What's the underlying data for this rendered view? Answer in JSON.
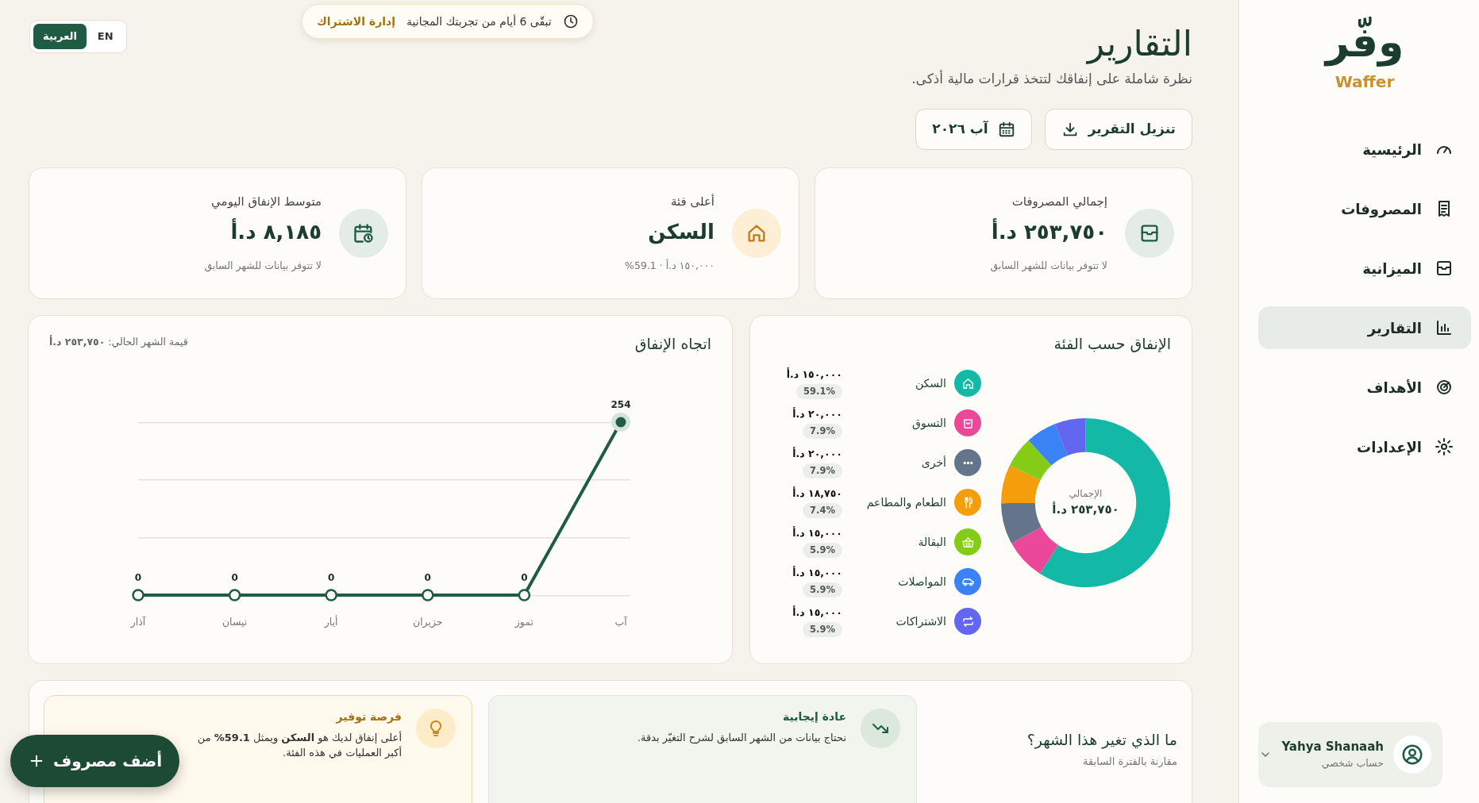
{
  "top_bar": {
    "trial": {
      "text": "تبقّى 6 أيام من تجربتك المجانية",
      "link": "إدارة الاشتراك"
    },
    "languages": [
      {
        "label": "EN",
        "selected": false
      },
      {
        "label": "العربية",
        "selected": true
      }
    ]
  },
  "header": {
    "title": "التقارير",
    "subtitle": "نظرة شاملة على إنفاقك لتتخذ قرارات مالية أذكى.",
    "buttons": [
      {
        "kind": "download",
        "label": "تنزيل التقرير"
      },
      {
        "kind": "date",
        "label": "آب ٢٠٢٦"
      }
    ]
  },
  "stats": [
    {
      "label": "إجمالي المصروفات",
      "value": "٢٥٣,٧٥٠ د.أ",
      "note": "لا تتوفر بيانات للشهر السابق"
    },
    {
      "label": "أعلى فئة",
      "value": "السكن",
      "note": "١٥٠,٠٠٠ د.أ · 59.1%"
    },
    {
      "label": "متوسط الإنفاق اليومي",
      "value": "٨,١٨٥ د.أ",
      "note": "لا تتوفر بيانات للشهر السابق"
    }
  ],
  "category_card": {
    "title": "الإنفاق حسب الفئة",
    "total_label": "الإجمالي",
    "total": "٢٥٣,٧٥٠ د.أ",
    "legend": [
      {
        "amount": "١٥٠,٠٠٠ د.أ",
        "percent": "59.1%",
        "color": "#14b8a6"
      },
      {
        "amount": "٢٠,٠٠٠ د.أ",
        "percent": "7.9%",
        "color": "#ec4899"
      },
      {
        "amount": "٢٠,٠٠٠ د.أ",
        "percent": "7.9%",
        "color": "#64748b"
      },
      {
        "amount": "١٨,٧٥٠ د.أ",
        "percent": "7.4%",
        "color": "#f59e0b"
      },
      {
        "amount": "١٥,٠٠٠ د.أ",
        "percent": "5.9%",
        "color": "#84cc16"
      },
      {
        "amount": "١٥,٠٠٠ د.أ",
        "percent": "5.9%",
        "color": "#3b82f6"
      },
      {
        "amount": "١٥,٠٠٠ د.أ",
        "percent": "5.9%",
        "color": "#6366f1"
      }
    ],
    "chart_data": {
      "type": "donut",
      "categories": [
        "السكن",
        "التسوق",
        "أخرى",
        "الطعام والمطاعم",
        "البقالة",
        "المواصلات",
        "الاشتراكات"
      ],
      "values": [
        59.1,
        7.9,
        7.9,
        7.4,
        5.9,
        5.9,
        5.9
      ]
    }
  },
  "trend_card": {
    "title": "اتجاه الإنفاق",
    "current": "قيمة الشهر الحالي: **٢٥٣,٧٥٠ د.أ**",
    "chart_data": {
      "type": "line",
      "categories": [
        "آذار",
        "نيسان",
        "أيار",
        "حزيران",
        "تموز",
        "آب"
      ],
      "series": [
        {
          "color": "#1f5c43",
          "marker": "o",
          "values": [
            0,
            0,
            0,
            0,
            0,
            254
          ]
        }
      ],
      "data_labels": true
    }
  },
  "changes": {
    "title": "ما الذي تغير هذا الشهر؟",
    "subtitle": "مقارنة بالفترة السابقة",
    "insights": [
      {
        "kind": "positive",
        "label": "عادة إيجابية",
        "lines": [
          "نحتاج بيانات من الشهر السابق لشرح التغيّر بدقة."
        ]
      },
      {
        "kind": "saving",
        "label": "فرصة توفير",
        "lines": [
          "أعلى إنفاق لديك هو **السكن** ويمثل **59.1%** من",
          "أكبر العمليات في هذه الفئة."
        ]
      }
    ]
  },
  "fab": {
    "label": "أضف مصروف"
  },
  "sidebar": {
    "logo": "وفّر",
    "logo_latin": "Waffer",
    "items": [
      {
        "label": "الرئيسية",
        "selected": false
      },
      {
        "label": "المصروفات",
        "selected": false
      },
      {
        "label": "الميزانية",
        "selected": false
      },
      {
        "label": "التقارير",
        "selected": true
      },
      {
        "label": "الأهداف",
        "selected": false
      },
      {
        "label": "الإعدادات",
        "selected": false
      }
    ],
    "user": {
      "name": "Yahya Shanaah",
      "subtitle": "حساب شخصي"
    }
  }
}
